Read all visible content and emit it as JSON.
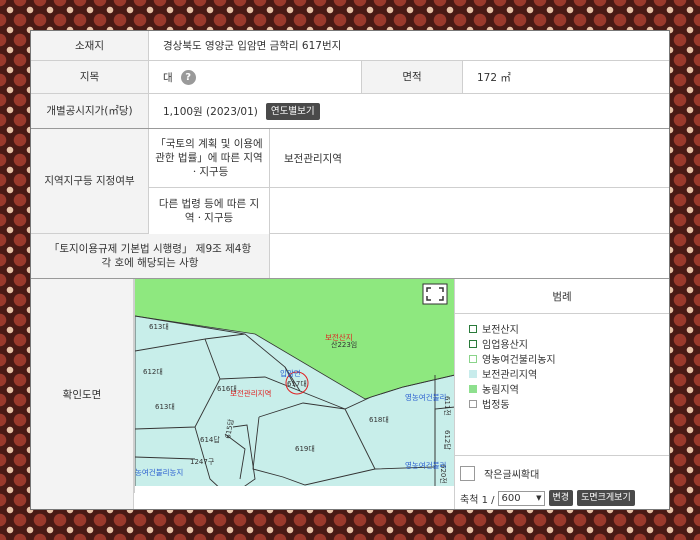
{
  "address": {
    "label": "소재지",
    "value": "경상북도 영양군 입암면 금학리 617번지"
  },
  "jimok": {
    "label": "지목",
    "value": "대",
    "help_icon": "?"
  },
  "area": {
    "label": "면적",
    "value": "172 ㎡"
  },
  "price": {
    "label": "개별공시지가(㎡당)",
    "value": "1,100원 (2023/01)",
    "button": "연도별보기"
  },
  "zoning": {
    "label": "지역지구등 지정여부",
    "sub1_label": "「국토의 계획 및 이용에 관한 법률」에 따른 지역ㆍ지구등",
    "sub1_value": "보전관리지역",
    "sub2_label": "다른 법령 등에 따른 지역ㆍ지구등",
    "sub2_value": ""
  },
  "enforcement": {
    "label": "「토지이용규제 기본법 시행령」 제9조 제4항 각 호에 해당되는 사항",
    "value": ""
  },
  "map_section": {
    "label": "확인도면"
  },
  "map_labels": {
    "p613a": "613대",
    "p612": "612대",
    "p616": "616대",
    "p617": "617대",
    "p613b": "613대",
    "p618": "618대",
    "p619": "619대",
    "p1247": "1247구",
    "p614": "614답",
    "p615": "615답",
    "zone_forest": "보전산지",
    "zone_forest_sub": "산223임",
    "zone_mgmt": "보전관리지역",
    "zone_agri_right1": "영농여건불리",
    "zone_agri_right2": "영농여건불리",
    "zone_agri_left": "농여건불리농지",
    "parcel_name": "입암면",
    "vert1": "611전",
    "vert2": "612답",
    "vert3": "620전"
  },
  "legend": {
    "title": "범례",
    "items": [
      {
        "label": "보전산지",
        "color": "#ffffff"
      },
      {
        "label": "임업용산지",
        "color": "#ffffff"
      },
      {
        "label": "영농여건불리농지",
        "color": "#ffffff"
      },
      {
        "label": "보전관리지역",
        "color": "#c8ecec"
      },
      {
        "label": "농림지역",
        "color": "#8ee08e"
      },
      {
        "label": "법정동",
        "color": "#ffffff"
      }
    ]
  },
  "controls": {
    "zoom_checkbox_label": "작은글씨확대",
    "scale_label": "축척 1 /",
    "scale_value": "600",
    "change_button": "변경",
    "large_view_button": "도면크게보기"
  },
  "colors": {
    "forest": "#8ee87f",
    "management": "#c8eeea",
    "parcel_line": "#333333",
    "red_label": "#e02020",
    "blue_label": "#2a5fd0"
  }
}
